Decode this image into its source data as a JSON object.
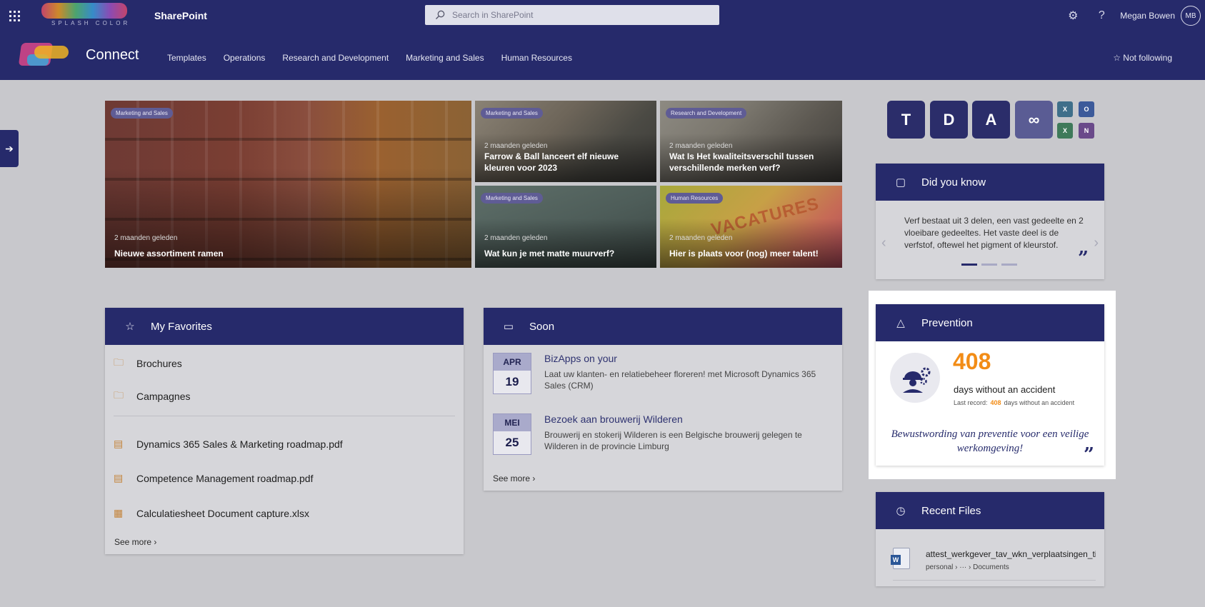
{
  "suite_bar": {
    "brand_text": "SPLASH COLOR",
    "app_name": "SharePoint",
    "search_placeholder": "Search in SharePoint",
    "user_name": "Megan Bowen",
    "user_initials": "MB",
    "icons": [
      "waffle-icon",
      "search-icon",
      "gear-icon",
      "help-icon"
    ]
  },
  "site_header": {
    "title": "Connect",
    "nav": [
      "Templates",
      "Operations",
      "Research and Development",
      "Marketing and Sales",
      "Human Resources"
    ],
    "follow_label": "Not following"
  },
  "hero": [
    {
      "tag": "Marketing and Sales",
      "meta": "2 maanden geleden",
      "title": "Nieuwe assortiment ramen"
    },
    {
      "tag": "Marketing and Sales",
      "meta": "2 maanden geleden",
      "title": "Farrow & Ball lanceert elf nieuwe kleuren voor 2023"
    },
    {
      "tag": "Research and Development",
      "meta": "2 maanden geleden",
      "title": "Wat Is Het kwaliteitsverschil tussen verschillende merken verf?"
    },
    {
      "tag": "Marketing and Sales",
      "meta": "2 maanden geleden",
      "title": "Wat kun je met matte muurverf?"
    },
    {
      "tag": "Human Resources",
      "meta": "2 maanden geleden",
      "title": "Hier is plaats voor (nog) meer talent!",
      "image_text": "VACATURES"
    }
  ],
  "favorites": {
    "title": "My Favorites",
    "folders": [
      "Brochures",
      "Campagnes"
    ],
    "files": [
      "Dynamics 365 Sales & Marketing roadmap.pdf",
      "Competence Management roadmap.pdf",
      "Calculatiesheet Document capture.xlsx"
    ],
    "see_more": "See more"
  },
  "soon": {
    "title": "Soon",
    "events": [
      {
        "month": "APR",
        "day": "19",
        "title": "BizApps on your",
        "desc": "Laat uw klanten- en relatiebeheer floreren! met Microsoft Dynamics 365 Sales (CRM)"
      },
      {
        "month": "MEI",
        "day": "25",
        "title": "Bezoek aan brouwerij Wilderen",
        "desc": "Brouwerij en stokerij Wilderen is een Belgische brouwerij gelegen te Wilderen in de provincie Limburg"
      }
    ],
    "see_more": "See more"
  },
  "did_you_know": {
    "title": "Did you know",
    "text": "Verf bestaat uit 3 delen, een vast gedeelte en 2 vloeibare gedeeltes. Het vaste deel is de verfstof, oftewel het pigment of kleurstof.",
    "slides": 3,
    "active_slide": 1
  },
  "prevention": {
    "title": "Prevention",
    "days": "408",
    "days_label": "days without an accident",
    "record_label": "Last record:",
    "record_value": "408",
    "record_suffix": "days without an accident",
    "quote": "Bewustwording van preventie voor een veilige werkomgeving!"
  },
  "recent_files": {
    "title": "Recent Files",
    "items": [
      {
        "name": "attest_werkgever_tav_wkn_verplaatsingen_tijdens_lockdown",
        "path_start": "personal",
        "path_mid": "···",
        "path_end": "Documents"
      }
    ]
  },
  "quick_links": [
    "Teams",
    "Dynamics",
    "Acrobat",
    "Creative Cloud",
    "Excel",
    "Outlook",
    "Excel",
    "OneNote"
  ],
  "colors": {
    "brand": "#262a6b",
    "accent": "#f28c16",
    "page_bg": "#c8c8cc"
  }
}
